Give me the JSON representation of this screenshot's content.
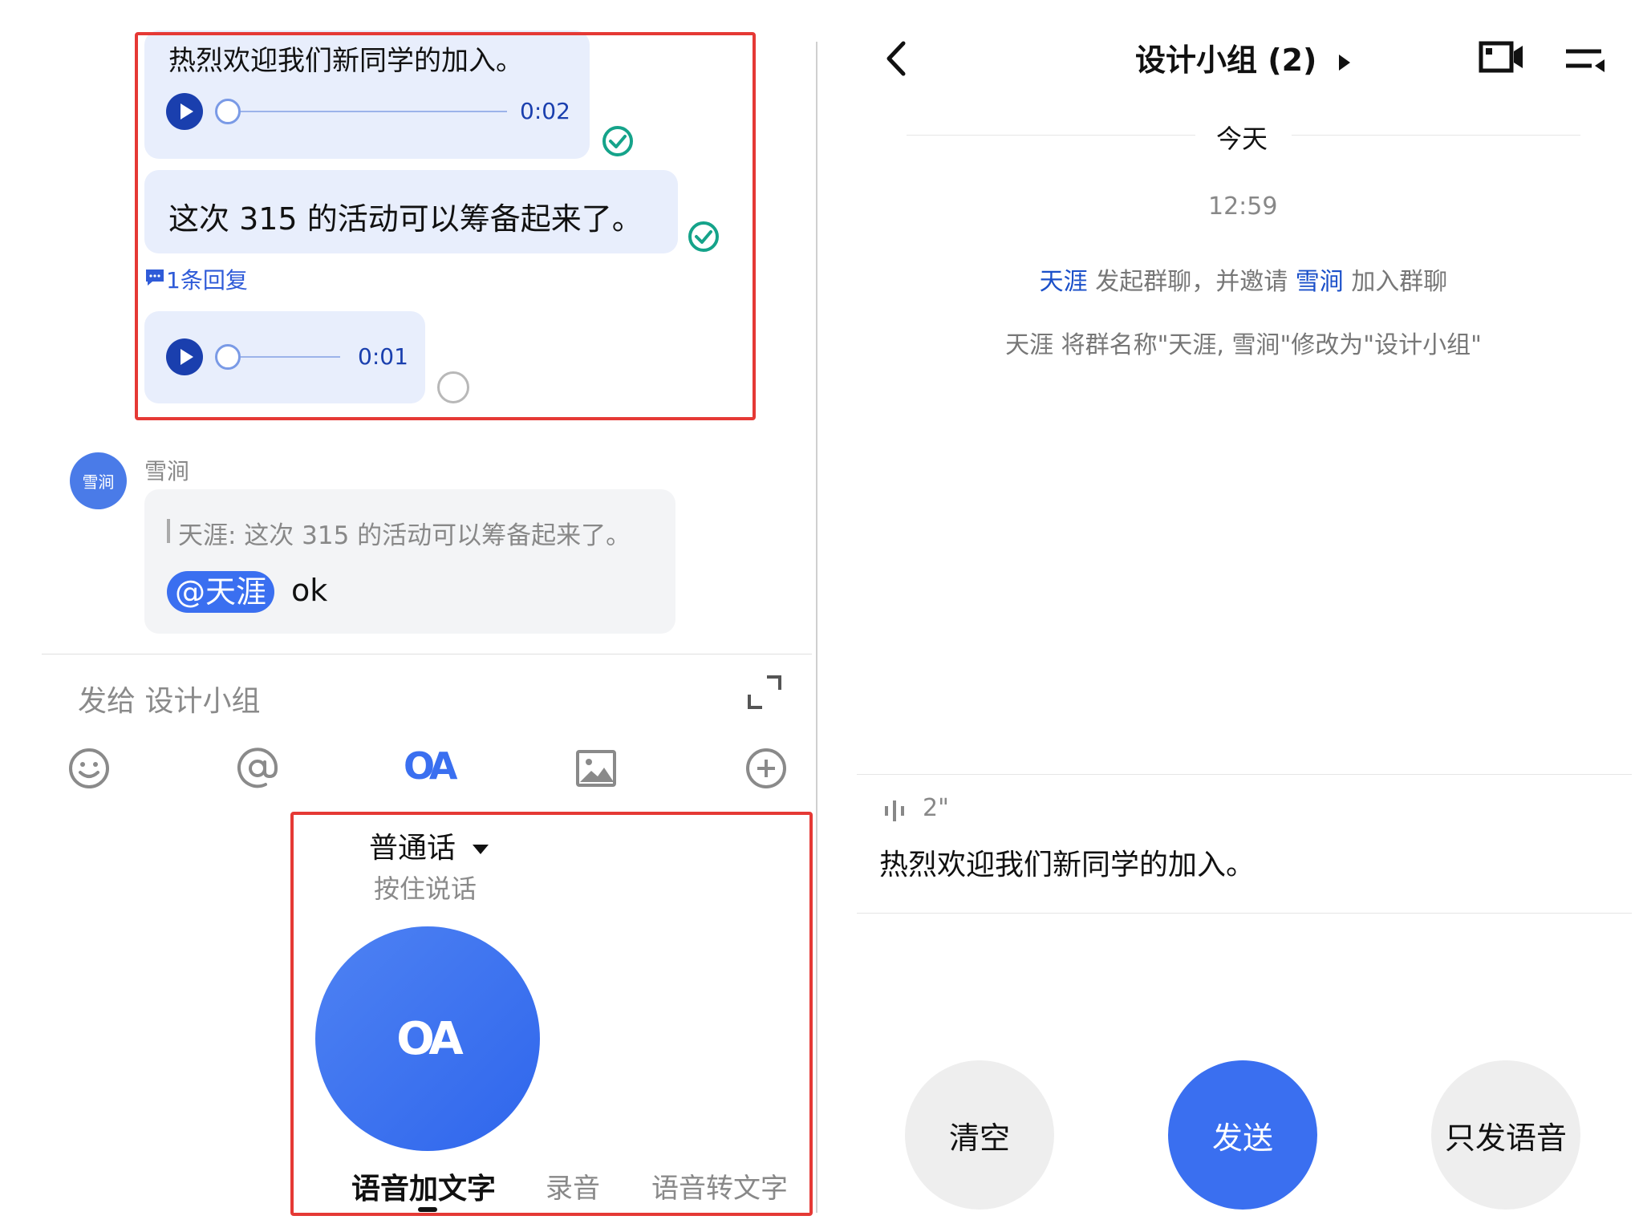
{
  "left": {
    "messages": [
      {
        "text": "热烈欢迎我们新同学的加入。",
        "duration": "0:02"
      },
      {
        "text": "这次 315 的活动可以筹备起来了。",
        "reply_count": "1条回复"
      },
      {
        "duration": "0:01"
      }
    ],
    "incoming": {
      "avatar_label": "雪涧",
      "sender": "雪涧",
      "quote": "天涯: 这次 315 的活动可以筹备起来了。",
      "mention": "@天涯",
      "text": "ok"
    },
    "composer": {
      "placeholder": "发给 设计小组"
    },
    "voice_panel": {
      "language": "普通话",
      "hint": "按住说话",
      "mic_label": "OA",
      "tabs": [
        "语音加文字",
        "录音",
        "语音转文字"
      ],
      "active_tab": 0
    },
    "toolbar": {
      "oa_label": "OA"
    }
  },
  "right": {
    "header": {
      "title": "设计小组 (2)"
    },
    "date_divider": "今天",
    "time": "12:59",
    "system_line1": {
      "user1": "天涯",
      "action": "发起群聊，并邀请",
      "user2": "雪涧",
      "suffix": "加入群聊"
    },
    "system_line2": "天涯 将群名称\"天涯, 雪涧\"修改为\"设计小组\"",
    "transcription": {
      "duration": "2\"",
      "text": "热烈欢迎我们新同学的加入。"
    },
    "buttons": {
      "clear": "清空",
      "send": "发送",
      "voice_only": "只发语音"
    }
  },
  "colors": {
    "accent": "#3a6ff0",
    "dark_blue": "#1a3fae",
    "bubble_blue": "#e8eefc",
    "bubble_grey": "#f3f4f6",
    "check_green": "#15a38a",
    "highlight_red": "#e53935"
  }
}
